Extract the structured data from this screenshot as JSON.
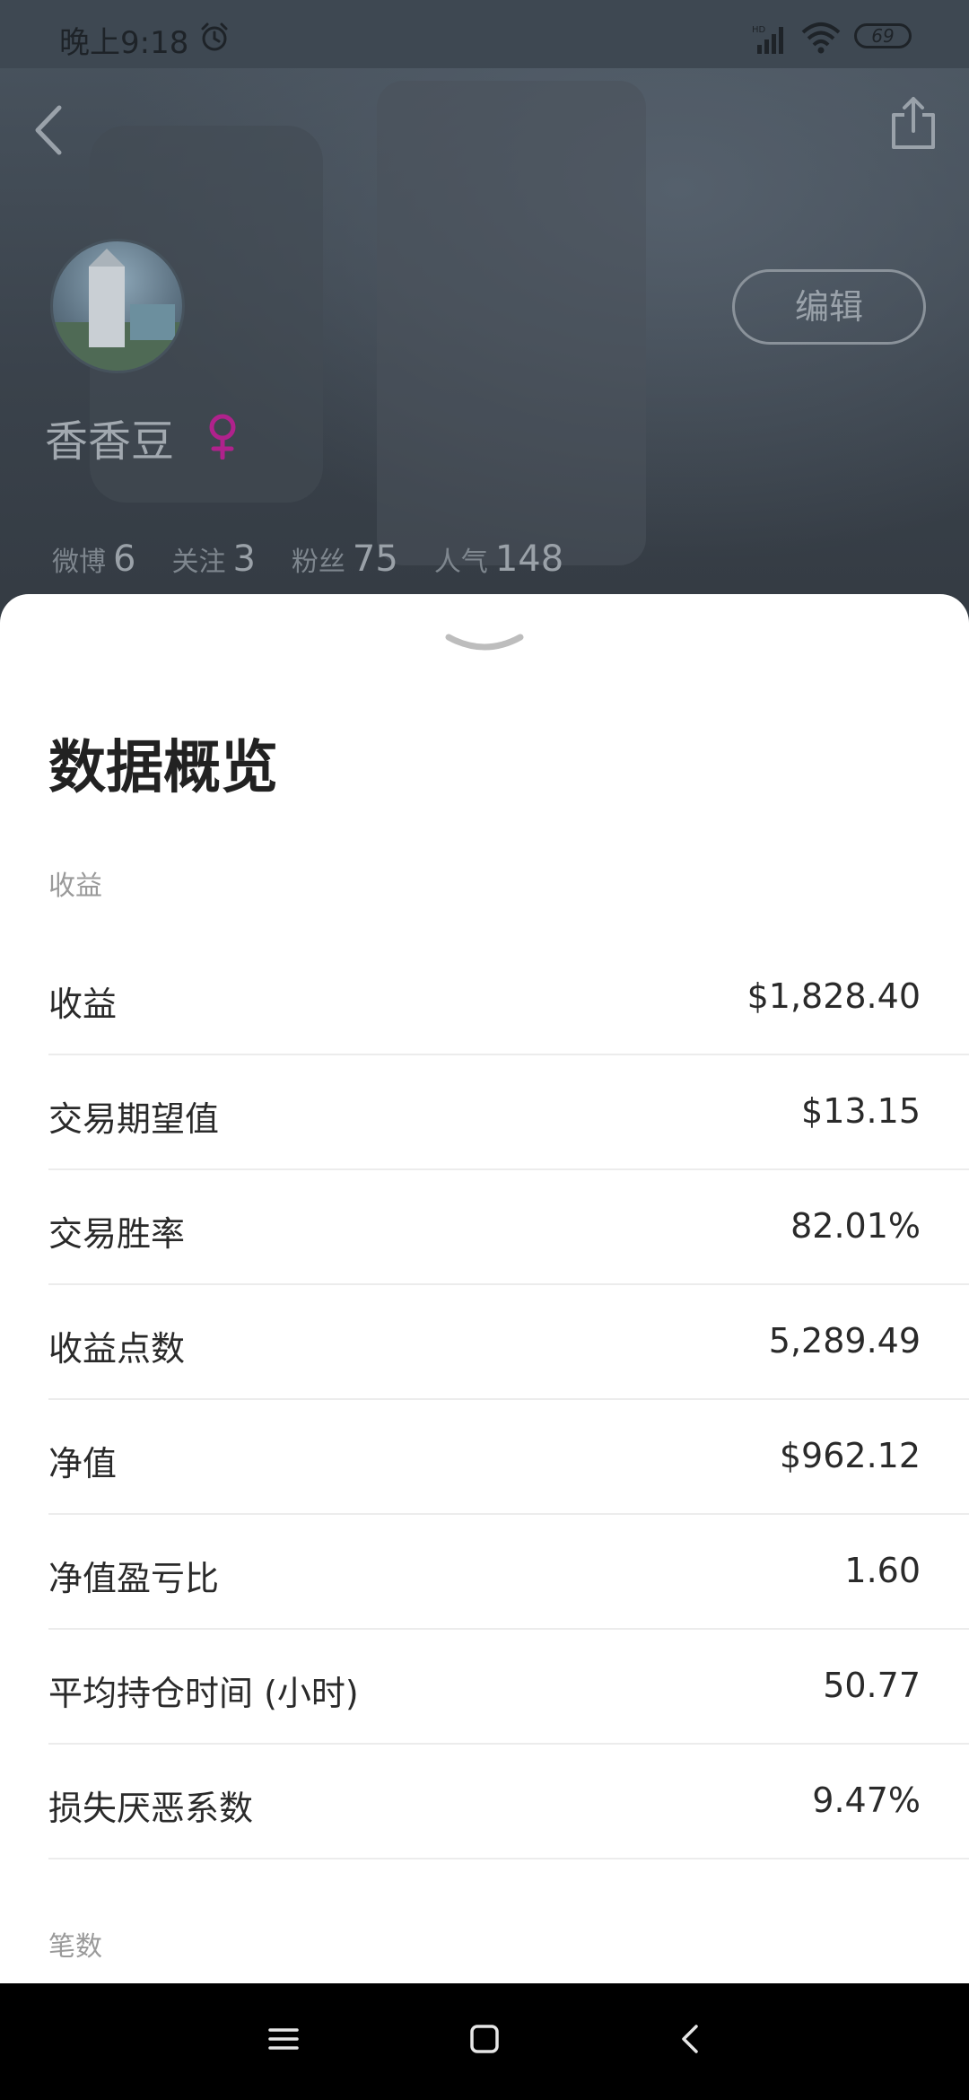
{
  "status_bar": {
    "time": "晚上9:18",
    "network": "HD",
    "battery": "69"
  },
  "profile": {
    "username": "香香豆",
    "edit_label": "编辑",
    "gender_color": "#b0228c",
    "stats": [
      {
        "label": "微博",
        "value": "6"
      },
      {
        "label": "关注",
        "value": "3"
      },
      {
        "label": "粉丝",
        "value": "75"
      },
      {
        "label": "人气",
        "value": "148"
      }
    ]
  },
  "sheet": {
    "title": "数据概览",
    "sections": [
      {
        "label": "收益",
        "rows": [
          {
            "label": "收益",
            "value": "$1,828.40"
          },
          {
            "label": "交易期望值",
            "value": "$13.15"
          },
          {
            "label": "交易胜率",
            "value": "82.01%"
          },
          {
            "label": "收益点数",
            "value": "5,289.49"
          },
          {
            "label": "净值",
            "value": "$962.12"
          },
          {
            "label": "净值盈亏比",
            "value": "1.60"
          },
          {
            "label": "平均持仓时间 (小时)",
            "value": "50.77"
          },
          {
            "label": "损失厌恶系数",
            "value": "9.47%"
          }
        ]
      },
      {
        "label": "笔数",
        "rows": []
      }
    ]
  }
}
